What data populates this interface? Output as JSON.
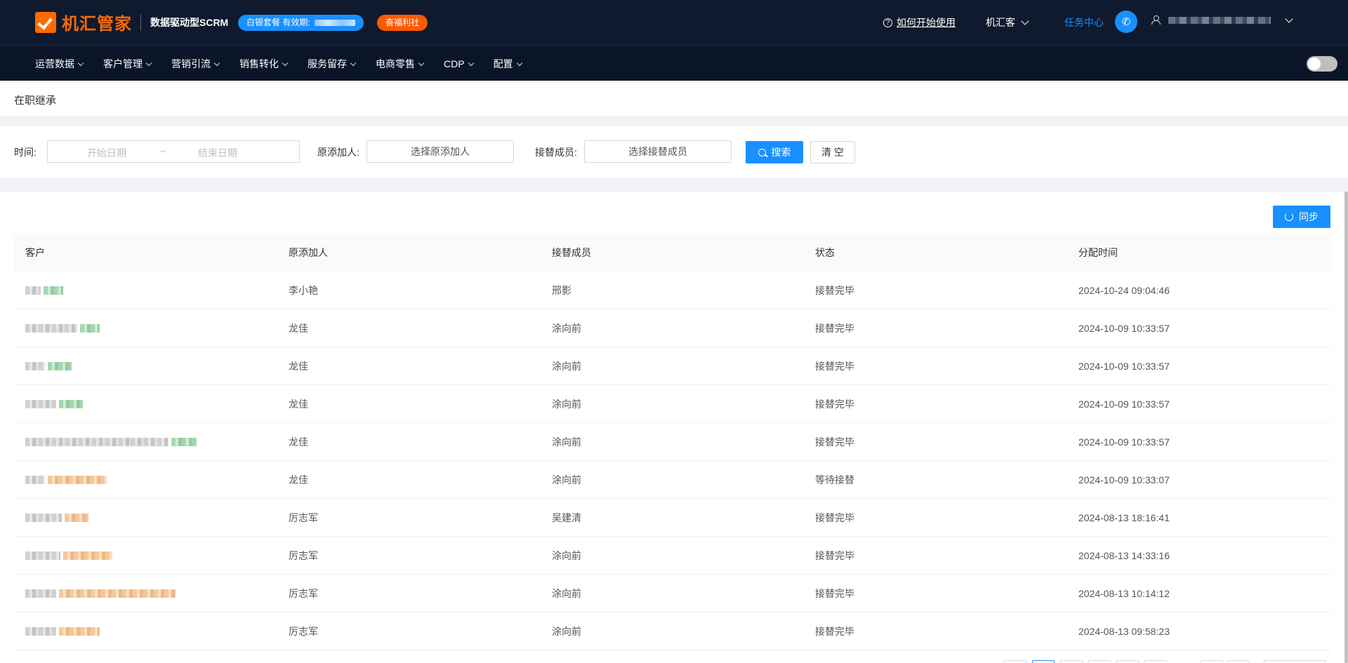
{
  "header": {
    "logo_text": "机汇管家",
    "slogan": "数据驱动型SCRM",
    "plan_label": "白银套餐 有效期:",
    "welfare_label": "奋福利社",
    "help_label": "如何开始使用",
    "help_icon": "question-circle-icon",
    "org_name": "机汇客",
    "task_center": "任务中心",
    "phone_icon": "phone-icon",
    "user_icon": "user-icon"
  },
  "nav": {
    "items": [
      {
        "label": "运营数据"
      },
      {
        "label": "客户管理"
      },
      {
        "label": "营销引流"
      },
      {
        "label": "销售转化"
      },
      {
        "label": "服务留存"
      },
      {
        "label": "电商零售"
      },
      {
        "label": "CDP"
      },
      {
        "label": "配置"
      }
    ]
  },
  "page": {
    "title": "在职继承"
  },
  "filter": {
    "time_label": "时间:",
    "start_placeholder": "开始日期",
    "range_separator": "~",
    "end_placeholder": "结束日期",
    "original_label": "原添加人:",
    "original_placeholder": "选择原添加人",
    "successor_label": "接替成员:",
    "successor_placeholder": "选择接替成员",
    "search_button": "搜索",
    "clear_button": "清 空"
  },
  "actions": {
    "sync_button": "同步"
  },
  "table": {
    "columns": [
      "客户",
      "原添加人",
      "接替成员",
      "状态",
      "分配时间"
    ],
    "rows": [
      {
        "original": "李小艳",
        "successor": "邢影",
        "status": "接替完毕",
        "time": "2024-10-24 09:04:46"
      },
      {
        "original": "龙佳",
        "successor": "涂向前",
        "status": "接替完毕",
        "time": "2024-10-09 10:33:57"
      },
      {
        "original": "龙佳",
        "successor": "涂向前",
        "status": "接替完毕",
        "time": "2024-10-09 10:33:57"
      },
      {
        "original": "龙佳",
        "successor": "涂向前",
        "status": "接替完毕",
        "time": "2024-10-09 10:33:57"
      },
      {
        "original": "龙佳",
        "successor": "涂向前",
        "status": "接替完毕",
        "time": "2024-10-09 10:33:57"
      },
      {
        "original": "龙佳",
        "successor": "涂向前",
        "status": "等待接替",
        "time": "2024-10-09 10:33:07"
      },
      {
        "original": "厉志军",
        "successor": "吴建清",
        "status": "接替完毕",
        "time": "2024-08-13 18:16:41"
      },
      {
        "original": "厉志军",
        "successor": "涂向前",
        "status": "接替完毕",
        "time": "2024-08-13 14:33:16"
      },
      {
        "original": "厉志军",
        "successor": "涂向前",
        "status": "接替完毕",
        "time": "2024-08-13 10:14:12"
      },
      {
        "original": "厉志军",
        "successor": "涂向前",
        "status": "接替完毕",
        "time": "2024-08-13 09:58:23"
      }
    ]
  },
  "colors": {
    "header_bg": "#0f1a2e",
    "nav_bg": "#0a1628",
    "primary": "#1890ff",
    "brand_orange": "#ff6a00"
  }
}
